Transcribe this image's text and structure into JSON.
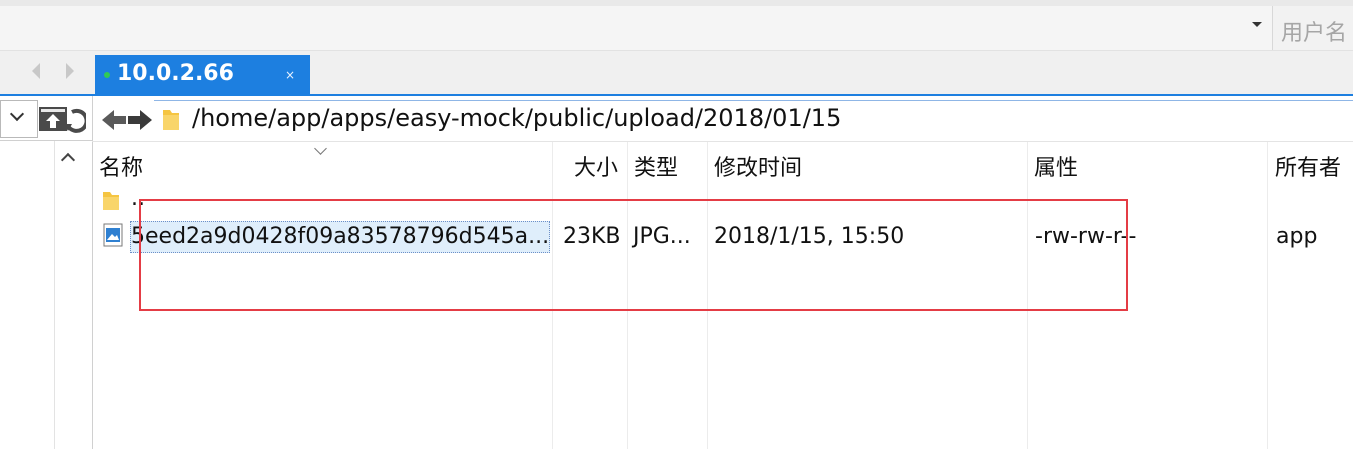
{
  "window": {
    "user_field_placeholder": "用户名"
  },
  "tab": {
    "label": "10.0.2.66",
    "close_glyph": "×"
  },
  "address_bar": {
    "path": "/home/app/apps/easy-mock/public/upload/2018/01/15"
  },
  "file_list": {
    "columns": [
      "名称",
      "大小",
      "类型",
      "修改时间",
      "属性",
      "所有者"
    ],
    "rows": [
      {
        "name": "..",
        "size": "",
        "type": "",
        "modified": "",
        "attrs": "",
        "owner": "",
        "icon": "folder-icon"
      },
      {
        "name": "5eed2a9d0428f09a83578796d545a...",
        "size": "23KB",
        "type": "JPG...",
        "modified": "2018/1/15, 15:50",
        "attrs": "-rw-rw-r--",
        "owner": "app",
        "icon": "image-file-icon"
      }
    ]
  },
  "colors": {
    "accent": "#1d7fe0",
    "connected_dot": "#31c954",
    "highlight": "#e43c45",
    "folder": "#f5c542"
  }
}
